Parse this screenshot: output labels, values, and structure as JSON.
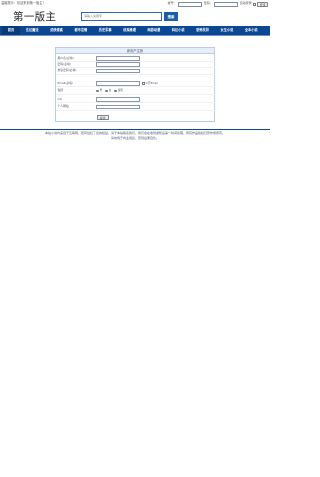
{
  "topbar": {
    "notice": "温馨提示：欢迎来到第一版主！",
    "account_label": "帐号：",
    "password_label": "密码：",
    "remember_label": "自动登录",
    "login_button": "登录"
  },
  "header": {
    "logo_text": "第一版主",
    "search_placeholder": "请输入关键字",
    "search_button": "搜索"
  },
  "nav": {
    "items": [
      "首页",
      "玄幻魔法",
      "武侠修真",
      "都市言情",
      "历史军事",
      "侦探推理",
      "网游动漫",
      "科幻小说",
      "恐怖灵异",
      "女生小说",
      "全本小说"
    ],
    "active_index": 0
  },
  "form": {
    "title": "新用户注册",
    "rows": [
      {
        "label": "用户名(必填)",
        "value": ""
      },
      {
        "label": "密码(必填)",
        "value": ""
      },
      {
        "label": "重复密码(必填)",
        "value": ""
      },
      {
        "label": "Email(必填)",
        "value": "",
        "note": "公开Email"
      },
      {
        "label": "性别",
        "radio": [
          "男",
          "女",
          "保密"
        ],
        "selected": 2
      },
      {
        "label": "QQ",
        "value": ""
      },
      {
        "label": "个人网站",
        "value": ""
      }
    ],
    "submit_label": "提交"
  },
  "footer": {
    "line1": "本站小说均来自于互联网，若有侵犯了您的权益，请于本站联系我们，我们会在收到通知后第一时间处理，所有作品版权归原作者所有。",
    "line2": "请勿用于商业用途，否则后果自负。"
  },
  "colors": {
    "nav_bg": "#0b4793",
    "accent": "#1c5dab",
    "panel_border": "#b9cde6",
    "panel_header": "#e6eef8"
  }
}
